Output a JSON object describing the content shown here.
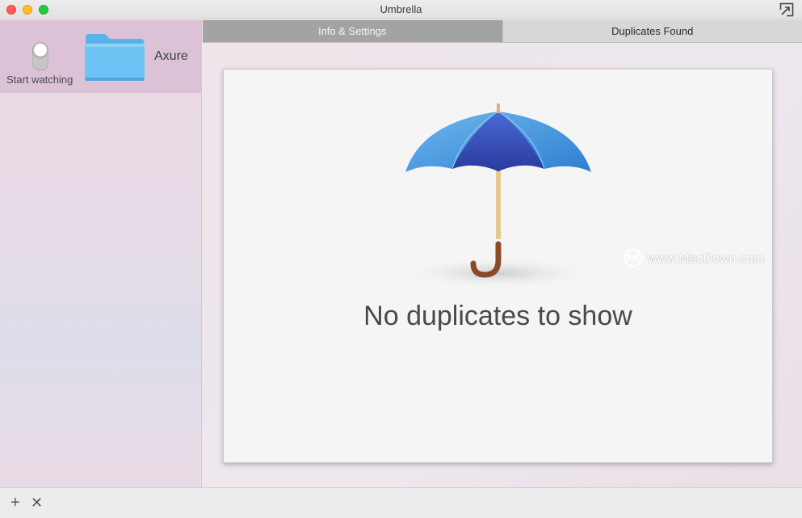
{
  "window": {
    "title": "Umbrella"
  },
  "sidebar": {
    "folders": [
      {
        "name": "Axure",
        "watch_label": "Start watching"
      }
    ]
  },
  "tabs": [
    {
      "label": "Info & Settings",
      "active": true
    },
    {
      "label": "Duplicates Found",
      "active": false
    }
  ],
  "main": {
    "empty_message": "No duplicates to show"
  },
  "watermark": {
    "text": "www.MacDown.com"
  },
  "bottombar": {
    "add_label": "+",
    "remove_label": "✕"
  },
  "colors": {
    "folder_blue": "#6cc3f4",
    "umbrella_blue": "#3a7fd0",
    "tab_active": "#a3a3a3",
    "sidebar_selected": "#dcc2d6"
  },
  "icons": [
    "close-icon",
    "minimize-icon",
    "maximize-icon",
    "expand-icon",
    "toggle-switch",
    "folder-icon",
    "umbrella-icon",
    "add-icon",
    "remove-icon"
  ]
}
